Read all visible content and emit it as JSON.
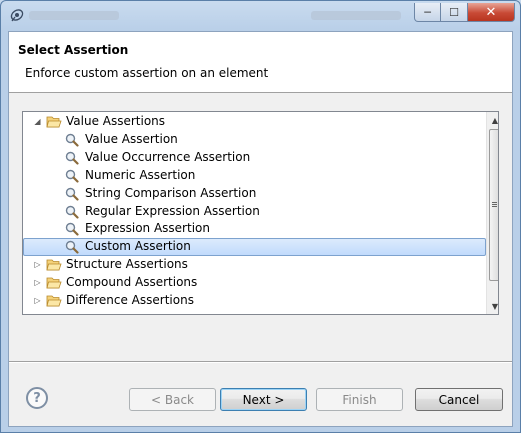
{
  "window": {
    "title": "",
    "controls": {
      "minimize": "─",
      "maximize": "☐",
      "close": "✕"
    }
  },
  "header": {
    "title": "Select Assertion",
    "description": "Enforce custom assertion on an element"
  },
  "tree": {
    "items": [
      {
        "label": "Value Assertions",
        "level": 0,
        "type": "folder",
        "expanded": true
      },
      {
        "label": "Value Assertion",
        "level": 1,
        "type": "assertion"
      },
      {
        "label": "Value Occurrence Assertion",
        "level": 1,
        "type": "assertion"
      },
      {
        "label": "Numeric Assertion",
        "level": 1,
        "type": "assertion"
      },
      {
        "label": "String Comparison Assertion",
        "level": 1,
        "type": "assertion"
      },
      {
        "label": "Regular Expression Assertion",
        "level": 1,
        "type": "assertion"
      },
      {
        "label": "Expression Assertion",
        "level": 1,
        "type": "assertion"
      },
      {
        "label": "Custom Assertion",
        "level": 1,
        "type": "assertion",
        "selected": true
      },
      {
        "label": "Structure Assertions",
        "level": 0,
        "type": "folder",
        "expanded": false
      },
      {
        "label": "Compound Assertions",
        "level": 0,
        "type": "folder",
        "expanded": false
      },
      {
        "label": "Difference Assertions",
        "level": 0,
        "type": "folder",
        "expanded": false
      }
    ]
  },
  "buttons": {
    "help": "?",
    "back": "< Back",
    "next": "Next >",
    "finish": "Finish",
    "cancel": "Cancel"
  },
  "colors": {
    "selection": "#c1dbfc",
    "folder": "#e8b84a"
  }
}
